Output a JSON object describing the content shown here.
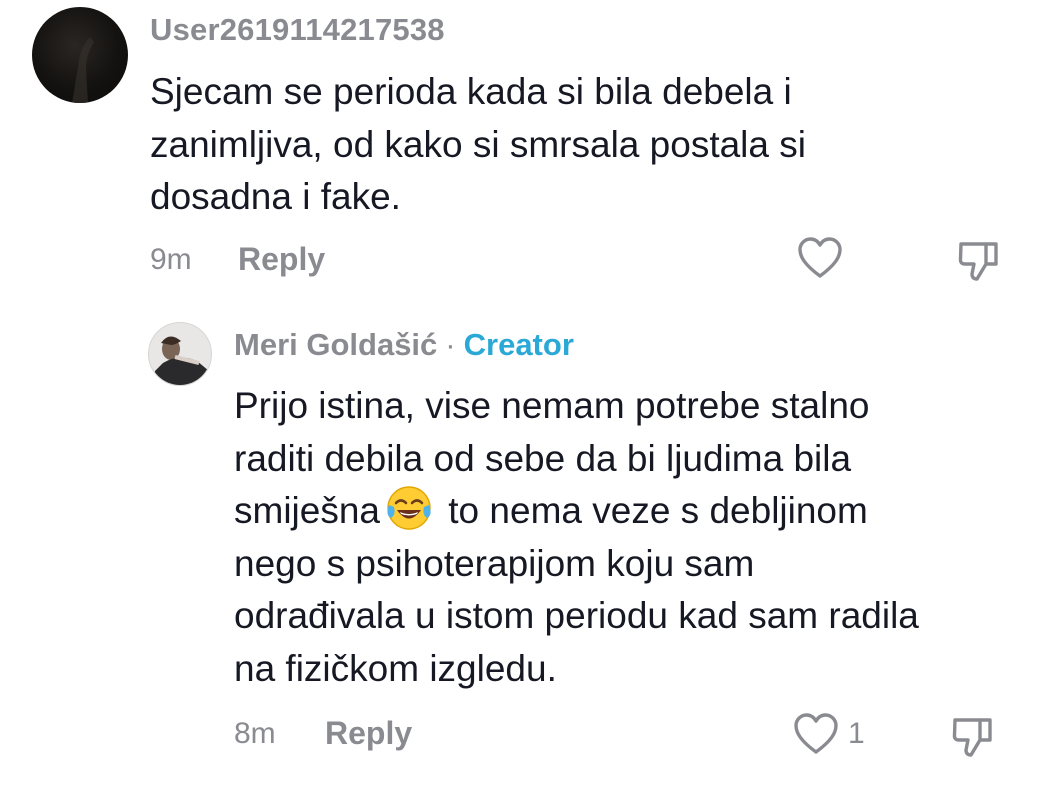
{
  "comment": {
    "username": "User2619114217538",
    "text": "Sjecam se perioda kada si bila debela i\nzanimljiva, od kako si smrsala postala si\ndosadna i fake.",
    "time": "9m",
    "reply_label": "Reply",
    "avatar_icon": "user-avatar-dark",
    "like_icon": "heart-outline-icon",
    "dislike_icon": "thumbs-down-icon"
  },
  "reply": {
    "username": "Meri Goldašić",
    "separator": "·",
    "badge": "Creator",
    "badge_color": "#2aa9d6",
    "text_part1": "Prijo istina, vise nemam potrebe stalno\nraditi debila od sebe da bi ljudima bila\nsmiješna",
    "emoji": "face-with-tears-of-joy",
    "text_part2": " to nema veze s debljinom\nnego s psihoterapijom koju sam\nodrađivala u istom periodu kad sam radila\nna fizičkom izgledu.",
    "time": "8m",
    "reply_label": "Reply",
    "like_count": "1",
    "like_icon": "heart-outline-icon",
    "dislike_icon": "thumbs-down-icon"
  }
}
